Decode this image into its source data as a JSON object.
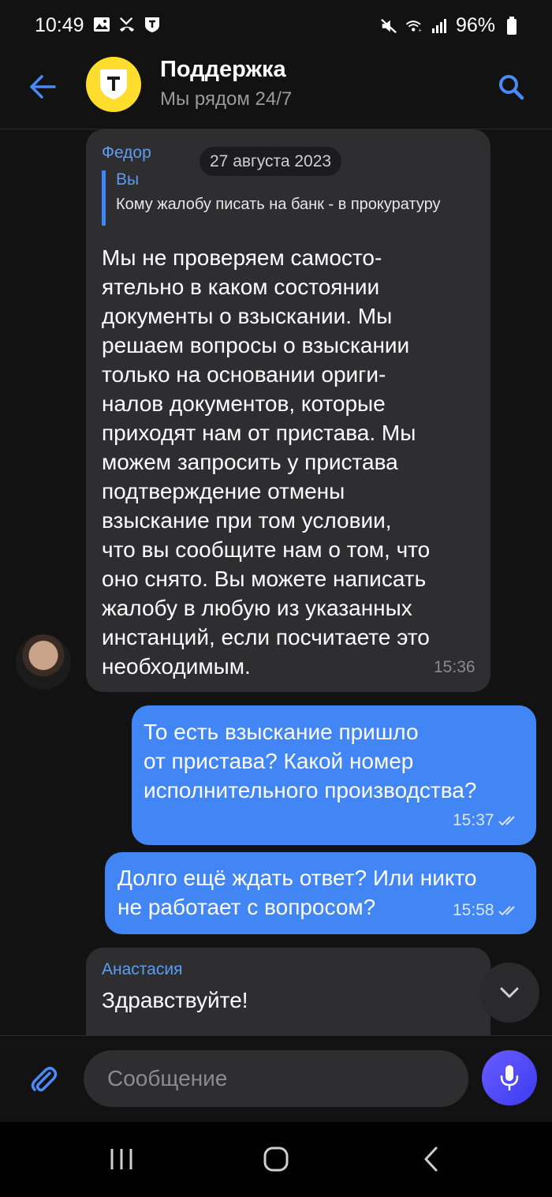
{
  "status_bar": {
    "time": "10:49",
    "battery": "96%",
    "icons_left": [
      "image-icon",
      "missed-call-icon",
      "app-t-icon"
    ],
    "icons_right": [
      "mute-icon",
      "wifi-icon",
      "signal-icon",
      "battery-icon"
    ]
  },
  "header": {
    "title": "Поддержка",
    "subtitle": "Мы рядом 24/7",
    "logo_letter": "т"
  },
  "chat": {
    "date": "27 августа 2023",
    "messages": [
      {
        "sender": "Федор",
        "reply_to_name": "Вы",
        "reply_to_text": "Кому жалобу писать на банк - в прокуратуру",
        "lines": [
          "Мы не проверяем самосто-",
          "ятельно в каком состоянии",
          "документы о взыскании. Мы",
          "решаем вопросы о взыскании",
          "только на основании ориги-",
          "налов документов, которые",
          "приходят нам от пристава. Мы",
          "можем запросить у пристава",
          "подтверждение отмены",
          "взыскание при том условии,",
          "что вы сообщите нам о том, что",
          "оно снято. Вы можете написать",
          "жалобу в любую из указанных",
          "инстанций, если посчитаете это",
          "необходимым."
        ],
        "time": "15:36"
      },
      {
        "lines": [
          "То есть взыскание пришло",
          "от пристава? Какой номер",
          "исполнительного производства?"
        ],
        "time": "15:37"
      },
      {
        "lines": [
          "Долго ещё ждать ответ? Или никто",
          "не работает с вопросом?"
        ],
        "time": "15:58"
      },
      {
        "sender": "Анастасия",
        "lines": [
          "Здравствуйте!"
        ]
      }
    ]
  },
  "input": {
    "placeholder": "Сообщение"
  },
  "colors": {
    "accent": "#4285f4",
    "brand_yellow": "#FFDD2D",
    "background": "#121212",
    "bubble_incoming": "#2e2e30"
  }
}
